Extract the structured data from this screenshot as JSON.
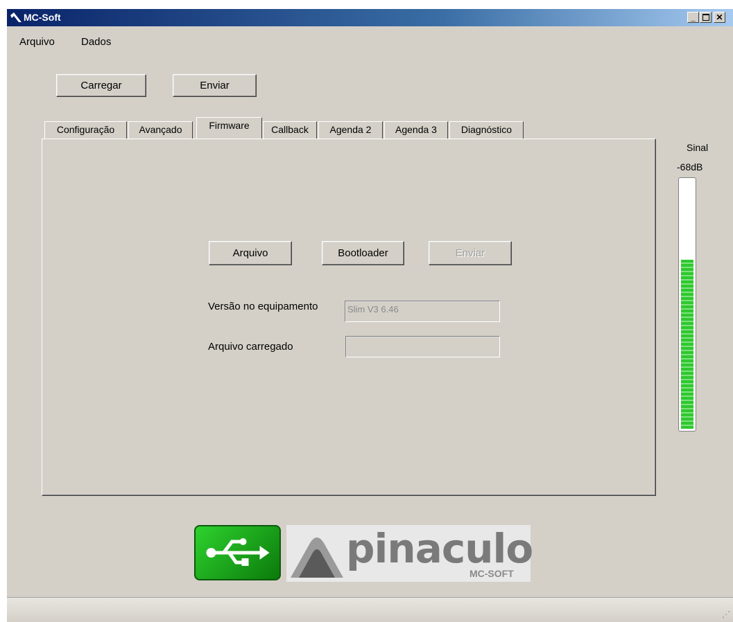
{
  "window": {
    "title": "MC-Soft",
    "controls": [
      "minimize-icon",
      "maximize-icon",
      "close-icon"
    ]
  },
  "menu": [
    "Arquivo",
    "Dados"
  ],
  "toolbar": {
    "load_label": "Carregar",
    "send_label": "Enviar"
  },
  "tabs": [
    {
      "label": "Configuração",
      "active": false
    },
    {
      "label": "Avançado",
      "active": false
    },
    {
      "label": "Firmware",
      "active": true
    },
    {
      "label": "Callback",
      "active": false
    },
    {
      "label": "Agenda 2",
      "active": false
    },
    {
      "label": "Agenda 3",
      "active": false
    },
    {
      "label": "Diagnóstico",
      "active": false
    }
  ],
  "firmware": {
    "file_button": "Arquivo",
    "bootloader_button": "Bootloader",
    "send_button": "Enviar",
    "send_enabled": false,
    "device_version_label": "Versão no equipamento",
    "device_version_value": "Slim V3 6.46",
    "loaded_file_label": "Arquivo carregado",
    "loaded_file_value": ""
  },
  "signal": {
    "label": "Sinal",
    "value": "-68dB",
    "level_fraction": 0.68,
    "color": "#2fc82f"
  },
  "footer": {
    "usb_icon": "usb-icon",
    "logo_text": "pinaculo",
    "logo_subtext": "MC-SOFT"
  }
}
